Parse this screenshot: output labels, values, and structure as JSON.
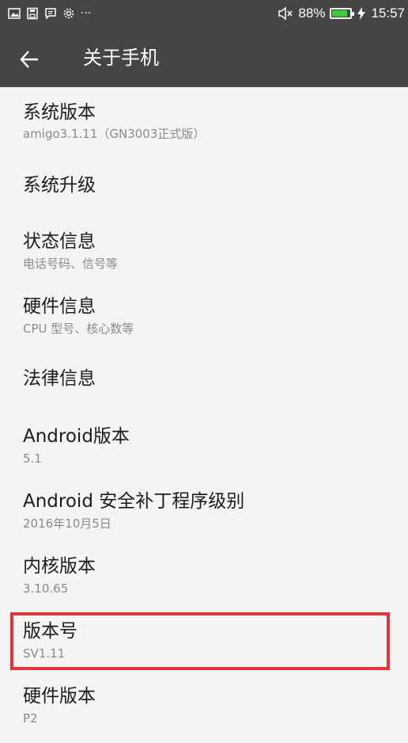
{
  "status_bar": {
    "icons": [
      "image-icon",
      "save-icon",
      "message-icon",
      "gear-icon"
    ],
    "more": "···",
    "battery_percent": "88%",
    "battery_level": 0.88,
    "time": "15:57",
    "accent_color": "#3ccb3c"
  },
  "header": {
    "title": "关于手机",
    "back_icon": "arrow-left-icon"
  },
  "items": [
    {
      "title": "系统版本",
      "sub": "amigo3.1.11（GN3003正式版）"
    },
    {
      "title": "系统升级",
      "sub": ""
    },
    {
      "title": "状态信息",
      "sub": "电话号码、信号等"
    },
    {
      "title": "硬件信息",
      "sub": "CPU 型号、核心数等"
    },
    {
      "title": "法律信息",
      "sub": ""
    },
    {
      "title": "Android版本",
      "sub": "5.1"
    },
    {
      "title": "Android 安全补丁程序级别",
      "sub": "2016年10月5日"
    },
    {
      "title": "内核版本",
      "sub": "3.10.65"
    },
    {
      "title": "版本号",
      "sub": "SV1.11"
    },
    {
      "title": "硬件版本",
      "sub": "P2"
    }
  ],
  "highlight_color": "#e8333a"
}
